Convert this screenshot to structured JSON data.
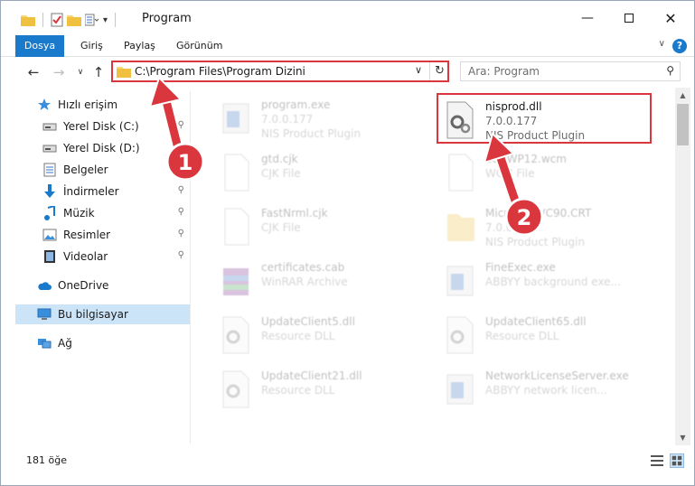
{
  "window": {
    "title": "Program"
  },
  "ribbon": {
    "tabs": [
      "Dosya",
      "Giriş",
      "Paylaş",
      "Görünüm"
    ],
    "help": "?"
  },
  "address": {
    "path": "C:\\Program Files\\Program Dizini"
  },
  "search": {
    "placeholder": "Ara: Program"
  },
  "sidebar": {
    "items": [
      {
        "label": "Hızlı erişim",
        "icon": "star-icon"
      },
      {
        "label": "Yerel Disk (C:)",
        "icon": "drive-icon",
        "pinned": true
      },
      {
        "label": "Yerel Disk (D:)",
        "icon": "drive-icon",
        "pinned": true
      },
      {
        "label": "Belgeler",
        "icon": "documents-icon",
        "pinned": true
      },
      {
        "label": "İndirmeler",
        "icon": "download-icon",
        "pinned": true
      },
      {
        "label": "Müzik",
        "icon": "music-icon",
        "pinned": true
      },
      {
        "label": "Resimler",
        "icon": "pictures-icon",
        "pinned": true
      },
      {
        "label": "Videolar",
        "icon": "videos-icon",
        "pinned": true
      },
      {
        "label": "OneDrive",
        "icon": "cloud-icon"
      },
      {
        "label": "Bu bilgisayar",
        "icon": "computer-icon",
        "selected": true
      },
      {
        "label": "Ağ",
        "icon": "network-icon"
      }
    ]
  },
  "files": [
    {
      "name": "program.exe",
      "line2": "7.0.0.177",
      "line3": "NIS Product Plugin"
    },
    {
      "name": "nisprod.dll",
      "line2": "7.0.0.177",
      "line3": "NIS Product Plugin"
    },
    {
      "name": "gtd.cjk",
      "line2": "CJK File"
    },
    {
      "name": "SoftWP12.wcm",
      "line2": "WCM File"
    },
    {
      "name": "FastNrml.cjk",
      "line2": "CJK File"
    },
    {
      "name": "Microsoft.VC90.CRT",
      "line2": "7.0.0",
      "line3": "NIS Product Plugin"
    },
    {
      "name": "certificates.cab",
      "line2": "WinRAR Archive"
    },
    {
      "name": "FineExec.exe",
      "line2": "ABBYY background exe..."
    },
    {
      "name": "UpdateClient5.dll",
      "line2": "Resource DLL"
    },
    {
      "name": "UpdateClient65.dll",
      "line2": "Resource DLL"
    },
    {
      "name": "UpdateClient21.dll",
      "line2": "Resource DLL"
    },
    {
      "name": "NetworkLicenseServer.exe",
      "line2": "ABBYY network licen..."
    }
  ],
  "status": {
    "count": "181 öğe"
  },
  "annotations": {
    "badge1": "1",
    "badge2": "2"
  },
  "colors": {
    "accent": "#1979ca",
    "highlight": "#d9363e",
    "selected": "#cce4f7"
  }
}
